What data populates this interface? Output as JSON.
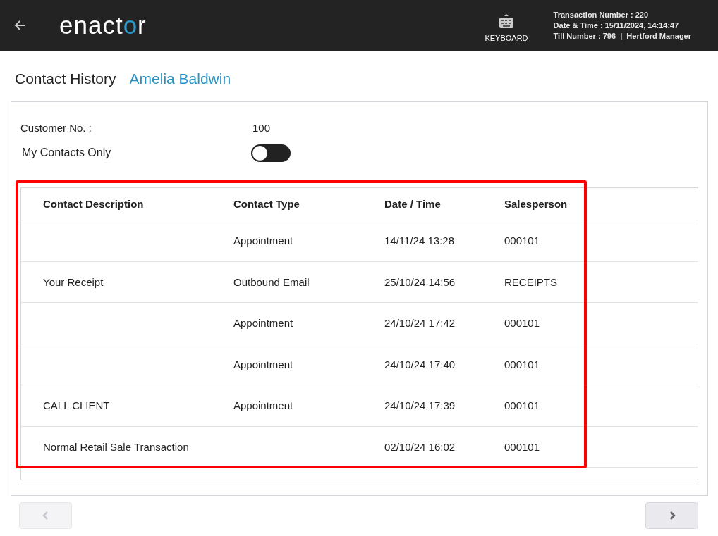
{
  "header": {
    "logo_start": "enact",
    "logo_mark": "o",
    "logo_end": "r",
    "keyboard_label": "KEYBOARD",
    "info_lines": [
      "Transaction Number : 220",
      "Date & Time : 15/11/2024, 14:14:47",
      "Till Number : 796  |  Hertford Manager"
    ]
  },
  "title": "Contact History",
  "customer_name": "Amelia Baldwin",
  "customer_no": {
    "label": "Customer No. :",
    "value": "100"
  },
  "my_contacts_only": {
    "label": "My Contacts Only",
    "on": false
  },
  "table": {
    "columns": [
      "Contact Description",
      "Contact Type",
      "Date / Time",
      "Salesperson"
    ],
    "rows": [
      [
        "",
        "Appointment",
        "14/11/24 13:28",
        "000101"
      ],
      [
        "Your Receipt",
        "Outbound Email",
        "25/10/24 14:56",
        "RECEIPTS"
      ],
      [
        "",
        "Appointment",
        "24/10/24 17:42",
        "000101"
      ],
      [
        "",
        "Appointment",
        "24/10/24 17:40",
        "000101"
      ],
      [
        "CALL CLIENT",
        "Appointment",
        "24/10/24 17:39",
        "000101"
      ],
      [
        "Normal Retail Sale Transaction",
        "",
        "02/10/24 16:02",
        "000101"
      ]
    ]
  },
  "pager": {
    "previous_disabled": true,
    "next_disabled": false
  }
}
